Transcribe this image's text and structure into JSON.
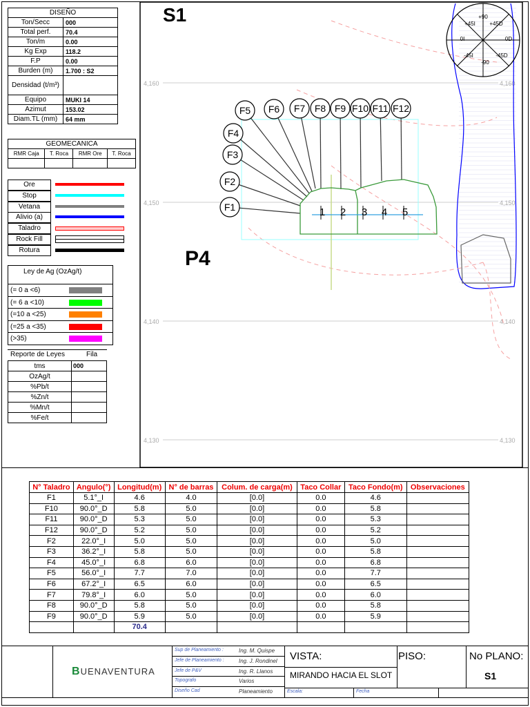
{
  "diseno": {
    "title": "DISEÑO",
    "rows": [
      {
        "label": "Ton/Secc",
        "value": "000"
      },
      {
        "label": "Total perf.",
        "value": "70.4"
      },
      {
        "label": "Ton/m",
        "value": "0.00"
      },
      {
        "label": "Kg Exp",
        "value": "118.2"
      },
      {
        "label": "F.P",
        "value": "0.00"
      },
      {
        "label": "Burden (m)",
        "value": "1.700 : S2"
      },
      {
        "label": "Densidad (t/m³)",
        "value": ""
      },
      {
        "label": "Equipo",
        "value": "MUKI 14"
      },
      {
        "label": "Azimut",
        "value": "153.02"
      },
      {
        "label": "Diam.TL (mm)",
        "value": "64 mm"
      }
    ]
  },
  "geomecanica": {
    "title": "GEOMECANICA",
    "headers": [
      "RMR Caja",
      "T. Roca",
      "RMR Ore",
      "T. Roca"
    ]
  },
  "legend": [
    {
      "label": "Ore",
      "color": "#ff0000"
    },
    {
      "label": "Stop",
      "color": "#00ffff"
    },
    {
      "label": "Vetana",
      "color": "#808080"
    },
    {
      "label": "Alivio (a)",
      "color": "#0000ff"
    },
    {
      "label": "Taladro",
      "color": "#ff0000"
    },
    {
      "label": "Rock Fill",
      "color": "#000000"
    },
    {
      "label": "Rotura",
      "color": "#000000"
    }
  ],
  "ley": {
    "title": "Ley de Ag (OzAg/t)",
    "rows": [
      {
        "label": "(= 0 a <6)",
        "color": "#808080"
      },
      {
        "label": "(= 6 a <10)",
        "color": "#00ff00"
      },
      {
        "label": "(=10 a <25)",
        "color": "#ff8000"
      },
      {
        "label": "(=25 a <35)",
        "color": "#ff0000"
      },
      {
        "label": "(>35)",
        "color": "#ff00ff"
      }
    ]
  },
  "reporte": {
    "title": "Reporte de Leyes",
    "fila": "Fila",
    "rows": [
      {
        "label": "tms",
        "value": "000"
      },
      {
        "label": "OzAg/t",
        "value": ""
      },
      {
        "label": "%Pb/t",
        "value": ""
      },
      {
        "label": "%Zn/t",
        "value": ""
      },
      {
        "label": "%Mn/t",
        "value": ""
      },
      {
        "label": "%Fe/t",
        "value": ""
      }
    ]
  },
  "drawing": {
    "section": "S1",
    "panel": "P4",
    "elevations": [
      "4,160",
      "4,150",
      "4,140",
      "4,130"
    ],
    "compass": [
      "+90",
      "+45I",
      "+45D",
      "0I",
      "0D",
      "-45I",
      "-45D",
      "-90"
    ],
    "holes": [
      "F1",
      "F2",
      "F3",
      "F4",
      "F5",
      "F6",
      "F7",
      "F8",
      "F9",
      "F10",
      "F11",
      "F12"
    ],
    "points": [
      "1",
      "2",
      "3",
      "4",
      "5"
    ]
  },
  "drill": {
    "headers": [
      "N° Taladro",
      "Angulo(°)",
      "Longitud(m)",
      "N° de barras",
      "Colum. de carga(m)",
      "Taco Collar",
      "Taco Fondo(m)",
      "Observaciones"
    ],
    "rows": [
      [
        "F1",
        "5.1°_I",
        "4.6",
        "4.0",
        "[0.0]",
        "0.0",
        "4.6",
        ""
      ],
      [
        "F10",
        "90.0°_D",
        "5.8",
        "5.0",
        "[0.0]",
        "0.0",
        "5.8",
        ""
      ],
      [
        "F11",
        "90.0°_D",
        "5.3",
        "5.0",
        "[0.0]",
        "0.0",
        "5.3",
        ""
      ],
      [
        "F12",
        "90.0°_D",
        "5.2",
        "5.0",
        "[0.0]",
        "0.0",
        "5.2",
        ""
      ],
      [
        "F2",
        "22.0°_I",
        "5.0",
        "5.0",
        "[0.0]",
        "0.0",
        "5.0",
        ""
      ],
      [
        "F3",
        "36.2°_I",
        "5.8",
        "5.0",
        "[0.0]",
        "0.0",
        "5.8",
        ""
      ],
      [
        "F4",
        "45.0°_I",
        "6.8",
        "6.0",
        "[0.0]",
        "0.0",
        "6.8",
        ""
      ],
      [
        "F5",
        "56.0°_I",
        "7.7",
        "7.0",
        "[0.0]",
        "0.0",
        "7.7",
        ""
      ],
      [
        "F6",
        "67.2°_I",
        "6.5",
        "6.0",
        "[0.0]",
        "0.0",
        "6.5",
        ""
      ],
      [
        "F7",
        "79.8°_I",
        "6.0",
        "5.0",
        "[0.0]",
        "0.0",
        "6.0",
        ""
      ],
      [
        "F8",
        "90.0°_D",
        "5.8",
        "5.0",
        "[0.0]",
        "0.0",
        "5.8",
        ""
      ],
      [
        "F9",
        "90.0°_D",
        "5.9",
        "5.0",
        "[0.0]",
        "0.0",
        "5.9",
        ""
      ]
    ],
    "total": "70.4"
  },
  "title_block": {
    "company": "BUENAVENTURA",
    "staff": [
      {
        "role": "Sup de Planeamiento :",
        "name": "Ing. M. Quispe"
      },
      {
        "role": "Jefe de Planeamiento :",
        "name": "Ing. J. Rondinel"
      },
      {
        "role": "Jefe de P&V",
        "name": "Ing. R. Llanos"
      },
      {
        "role": "Topografo",
        "name": "Varios"
      },
      {
        "role": "Diseño Cad",
        "name": "Planeamiento"
      }
    ],
    "vista_label": "VISTA:",
    "vista": "MIRANDO HACIA EL SLOT",
    "piso_label": "PISO:",
    "plano_label": "No PLANO:",
    "plano": "S1",
    "escala_label": "Escala:",
    "fecha_label": "Fecha"
  }
}
